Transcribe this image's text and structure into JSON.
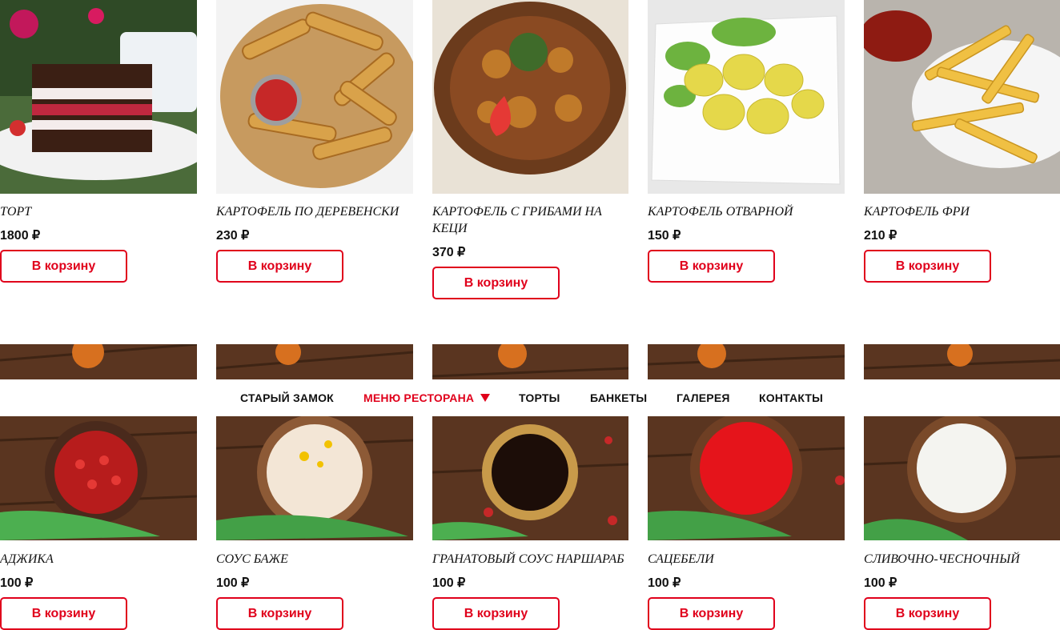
{
  "row1": [
    {
      "name": "Торт",
      "price": "1800 ₽",
      "button": "В корзину",
      "image": "cake-slice-photo"
    },
    {
      "name": "Картофель по деревенски",
      "price": "230 ₽",
      "button": "В корзину",
      "image": "country-potatoes-photo"
    },
    {
      "name": "Картофель с грибами на кеци",
      "price": "370 ₽",
      "button": "В корзину",
      "image": "potatoes-mushrooms-photo"
    },
    {
      "name": "Картофель отварной",
      "price": "150 ₽",
      "button": "В корзину",
      "image": "boiled-potatoes-photo"
    },
    {
      "name": "Картофель фри",
      "price": "210 ₽",
      "button": "В корзину",
      "image": "french-fries-photo"
    }
  ],
  "row2": [
    {
      "name": "Аджика",
      "price": "100 ₽",
      "button": "В корзину",
      "image": "adjika-sauce-photo"
    },
    {
      "name": "Соус баже",
      "price": "100 ₽",
      "button": "В корзину",
      "image": "bazhe-sauce-photo"
    },
    {
      "name": "Гранатовый соус наршараб",
      "price": "100 ₽",
      "button": "В корзину",
      "image": "narsharab-sauce-photo"
    },
    {
      "name": "Сацебели",
      "price": "100 ₽",
      "button": "В корзину",
      "image": "satsebeli-sauce-photo"
    },
    {
      "name": "Сливочно-чесночный",
      "price": "100 ₽",
      "button": "В корзину",
      "image": "garlic-cream-sauce-photo"
    }
  ],
  "nav": {
    "items": [
      "Старый замок",
      "Меню ресторана",
      "Торты",
      "Банкеты",
      "Галерея",
      "Контакты"
    ],
    "active_index": 1,
    "caret_icon": "caret-down-icon"
  },
  "colors": {
    "accent": "#e0001b",
    "text": "#111111",
    "background": "#ffffff"
  }
}
